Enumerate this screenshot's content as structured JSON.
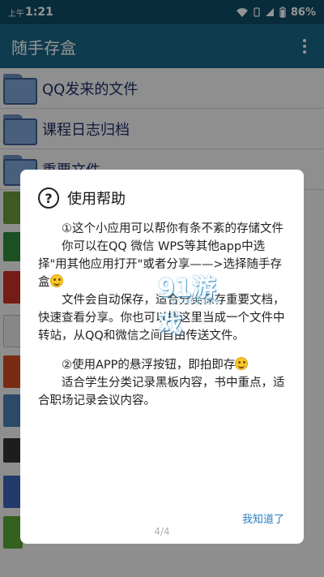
{
  "status_bar": {
    "time_prefix": "上午",
    "time": "1:21",
    "battery": "86%"
  },
  "app_bar": {
    "title": "随手存盒",
    "menu_icon": "overflow-menu-icon"
  },
  "list": {
    "items": [
      {
        "label": "QQ发来的文件",
        "icon": "folder-icon"
      },
      {
        "label": "课程日志归档",
        "icon": "folder-icon"
      },
      {
        "label": "重要文件",
        "icon": "folder-icon"
      }
    ]
  },
  "dialog": {
    "title": "使用帮助",
    "icon": "help-icon",
    "paragraphs": {
      "p1": "①这个小应用可以帮你有条不紊的存储文件",
      "p2": "你可以在QQ 微信 WPS等其他app中选择\"用其他应用打开\"或者分享——>选择随手存盒",
      "p3": "文件会自动保存，适合分类保存重要文档，快速查看分享。你也可以把这里当成一个文件中转站，从QQ和微信之间自由传送文件。",
      "p4": "②使用APP的悬浮按钮，即拍即存",
      "p5": "适合学生分类记录黑板内容，书中重点，适合职场记录会议内容。"
    },
    "ok_button": "我知道了",
    "pager": "4/4"
  },
  "watermark": {
    "big": "91游戏",
    "small": "91danji.com"
  },
  "colors": {
    "status_bar": "#0f4d66",
    "app_bar": "#1b6787",
    "accent": "#2a7fc0"
  }
}
